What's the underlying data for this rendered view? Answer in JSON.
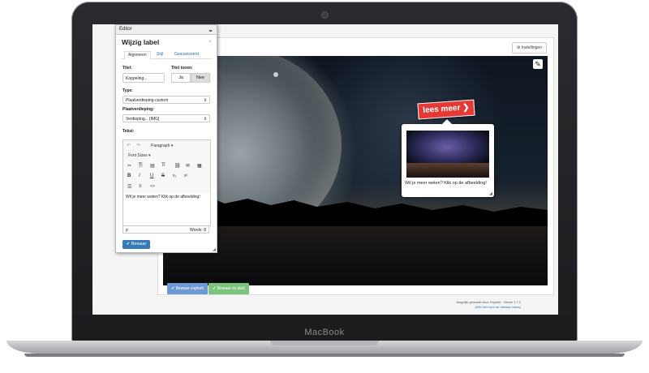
{
  "device": {
    "brand": "MacBook"
  },
  "app": {
    "settings_label": "⚙ Instellingen",
    "lees_meer": "lees meer ❯",
    "popup_text": "Wil je meer weten? Klik op de afbeelding!",
    "save_explorit": "✔ Bewaar explorit",
    "save_close": "✔ Bewaar en sluit",
    "footer_line1": "Mogelijk gemaakt door Explorit - Versie 1.7.2",
    "footer_line2": "(Klik hier voor de release notes)",
    "edit_icon": "✎"
  },
  "editor": {
    "header": "Editor",
    "chevron": "⌄",
    "title": "Wijzig label",
    "close": "×",
    "tabs": [
      "Algemeen",
      "Stijl",
      "Geavanceerd"
    ],
    "titel_label": "Titel:",
    "titel_value": "Koppeling...",
    "titel_tonen_label": "Titel tonen:",
    "toggle_ja": "Ja",
    "toggle_nee": "Nee",
    "type_label": "Type:",
    "type_value": "Plaatverdieping-custom",
    "verdieping_label": "Plaatverdieping:",
    "verdieping_value": "Verdieping... [IMG]",
    "tekst_label": "Tekst:",
    "toolbar": {
      "undo": "↶",
      "redo": "↷",
      "paragraph": "Paragraph",
      "font_sizes": "Font Sizes",
      "cut": "✂",
      "copy": "⎘",
      "paste": "▤",
      "clear": "T̸",
      "link": "⛓",
      "media": "✉",
      "image": "▦",
      "bold": "B",
      "italic": "I",
      "underline": "U",
      "strike": "S",
      "sub": "x₂",
      "sup": "x²",
      "ul": "☰",
      "ol": "≡",
      "code": "<>"
    },
    "text_content": "Wil je meer weten? Klik op de afbeelding!",
    "status_p": "p",
    "status_words": "Words: 8",
    "save_button": "✔ Bewaar"
  }
}
